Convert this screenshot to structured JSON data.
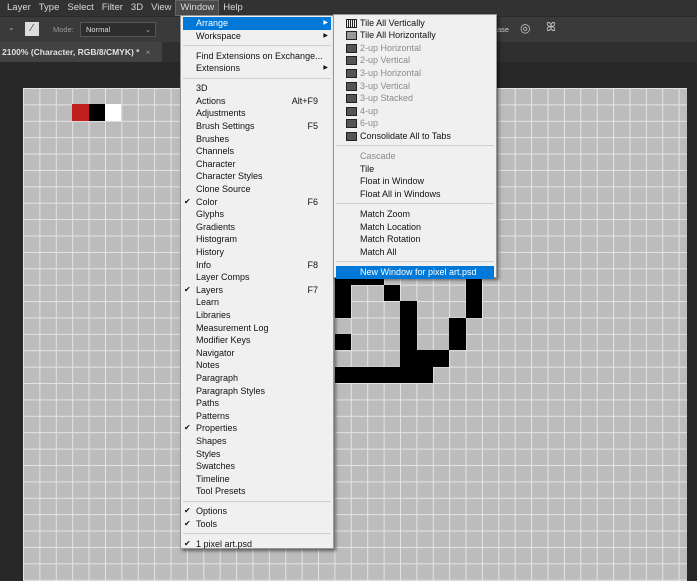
{
  "menubar": {
    "items": [
      "Layer",
      "Type",
      "Select",
      "Filter",
      "3D",
      "View",
      "Window",
      "Help"
    ],
    "active": "Window"
  },
  "options": {
    "mode_label": "Mode:",
    "mode_value": "Normal",
    "erase_fragment": "ase"
  },
  "document_tab": {
    "title": "2100% (Character, RGB/8/CMYK) *",
    "close": "×"
  },
  "canvas": {
    "swatch_colors": [
      "#c0201e",
      "#000000",
      "#ffffff"
    ],
    "black_pixels": [
      [
        11,
        19
      ],
      [
        11,
        20
      ],
      [
        11,
        21
      ],
      [
        11,
        27
      ],
      [
        12,
        19
      ],
      [
        12,
        22
      ],
      [
        12,
        27
      ],
      [
        13,
        19
      ],
      [
        13,
        23
      ],
      [
        13,
        27
      ],
      [
        14,
        23
      ],
      [
        14,
        26
      ],
      [
        15,
        19
      ],
      [
        15,
        23
      ],
      [
        15,
        26
      ],
      [
        16,
        23
      ],
      [
        16,
        24
      ],
      [
        16,
        25
      ],
      [
        17,
        19
      ],
      [
        17,
        20
      ],
      [
        17,
        21
      ],
      [
        17,
        22
      ],
      [
        17,
        23
      ],
      [
        17,
        24
      ]
    ]
  },
  "window_menu": {
    "items": [
      {
        "label": "Arrange",
        "submenu": true,
        "highlight": true
      },
      {
        "label": "Workspace",
        "submenu": true
      },
      {
        "sep": true
      },
      {
        "label": "Find Extensions on Exchange..."
      },
      {
        "label": "Extensions",
        "submenu": true
      },
      {
        "sep": true
      },
      {
        "label": "3D"
      },
      {
        "label": "Actions",
        "shortcut": "Alt+F9"
      },
      {
        "label": "Adjustments"
      },
      {
        "label": "Brush Settings",
        "shortcut": "F5"
      },
      {
        "label": "Brushes"
      },
      {
        "label": "Channels"
      },
      {
        "label": "Character"
      },
      {
        "label": "Character Styles"
      },
      {
        "label": "Clone Source"
      },
      {
        "label": "Color",
        "shortcut": "F6",
        "checked": true
      },
      {
        "label": "Glyphs"
      },
      {
        "label": "Gradients"
      },
      {
        "label": "Histogram"
      },
      {
        "label": "History"
      },
      {
        "label": "Info",
        "shortcut": "F8"
      },
      {
        "label": "Layer Comps"
      },
      {
        "label": "Layers",
        "shortcut": "F7",
        "checked": true
      },
      {
        "label": "Learn"
      },
      {
        "label": "Libraries"
      },
      {
        "label": "Measurement Log"
      },
      {
        "label": "Modifier Keys"
      },
      {
        "label": "Navigator"
      },
      {
        "label": "Notes"
      },
      {
        "label": "Paragraph"
      },
      {
        "label": "Paragraph Styles"
      },
      {
        "label": "Paths"
      },
      {
        "label": "Patterns"
      },
      {
        "label": "Properties",
        "checked": true
      },
      {
        "label": "Shapes"
      },
      {
        "label": "Styles"
      },
      {
        "label": "Swatches"
      },
      {
        "label": "Timeline"
      },
      {
        "label": "Tool Presets"
      },
      {
        "sep": true
      },
      {
        "label": "Options",
        "checked": true
      },
      {
        "label": "Tools",
        "checked": true
      },
      {
        "sep": true
      },
      {
        "label": "1 pixel art.psd",
        "checked": true
      }
    ]
  },
  "arrange_menu": {
    "items": [
      {
        "label": "Tile All Vertically",
        "icon": "v"
      },
      {
        "label": "Tile All Horizontally",
        "icon": "h"
      },
      {
        "label": "2-up Horizontal",
        "icon": "",
        "disabled": true
      },
      {
        "label": "2-up Vertical",
        "icon": "",
        "disabled": true
      },
      {
        "label": "3-up Horizontal",
        "icon": "",
        "disabled": true
      },
      {
        "label": "3-up Vertical",
        "icon": "",
        "disabled": true
      },
      {
        "label": "3-up Stacked",
        "icon": "",
        "disabled": true
      },
      {
        "label": "4-up",
        "icon": "",
        "disabled": true
      },
      {
        "label": "6-up",
        "icon": "",
        "disabled": true
      },
      {
        "label": "Consolidate All to Tabs",
        "icon": ""
      },
      {
        "sep": true
      },
      {
        "label": "Cascade",
        "disabled": true
      },
      {
        "label": "Tile"
      },
      {
        "label": "Float in Window"
      },
      {
        "label": "Float All in Windows"
      },
      {
        "sep": true
      },
      {
        "label": "Match Zoom"
      },
      {
        "label": "Match Location"
      },
      {
        "label": "Match Rotation"
      },
      {
        "label": "Match All"
      },
      {
        "sep": true
      },
      {
        "label": "New Window for pixel art.psd",
        "highlight": true
      }
    ]
  }
}
